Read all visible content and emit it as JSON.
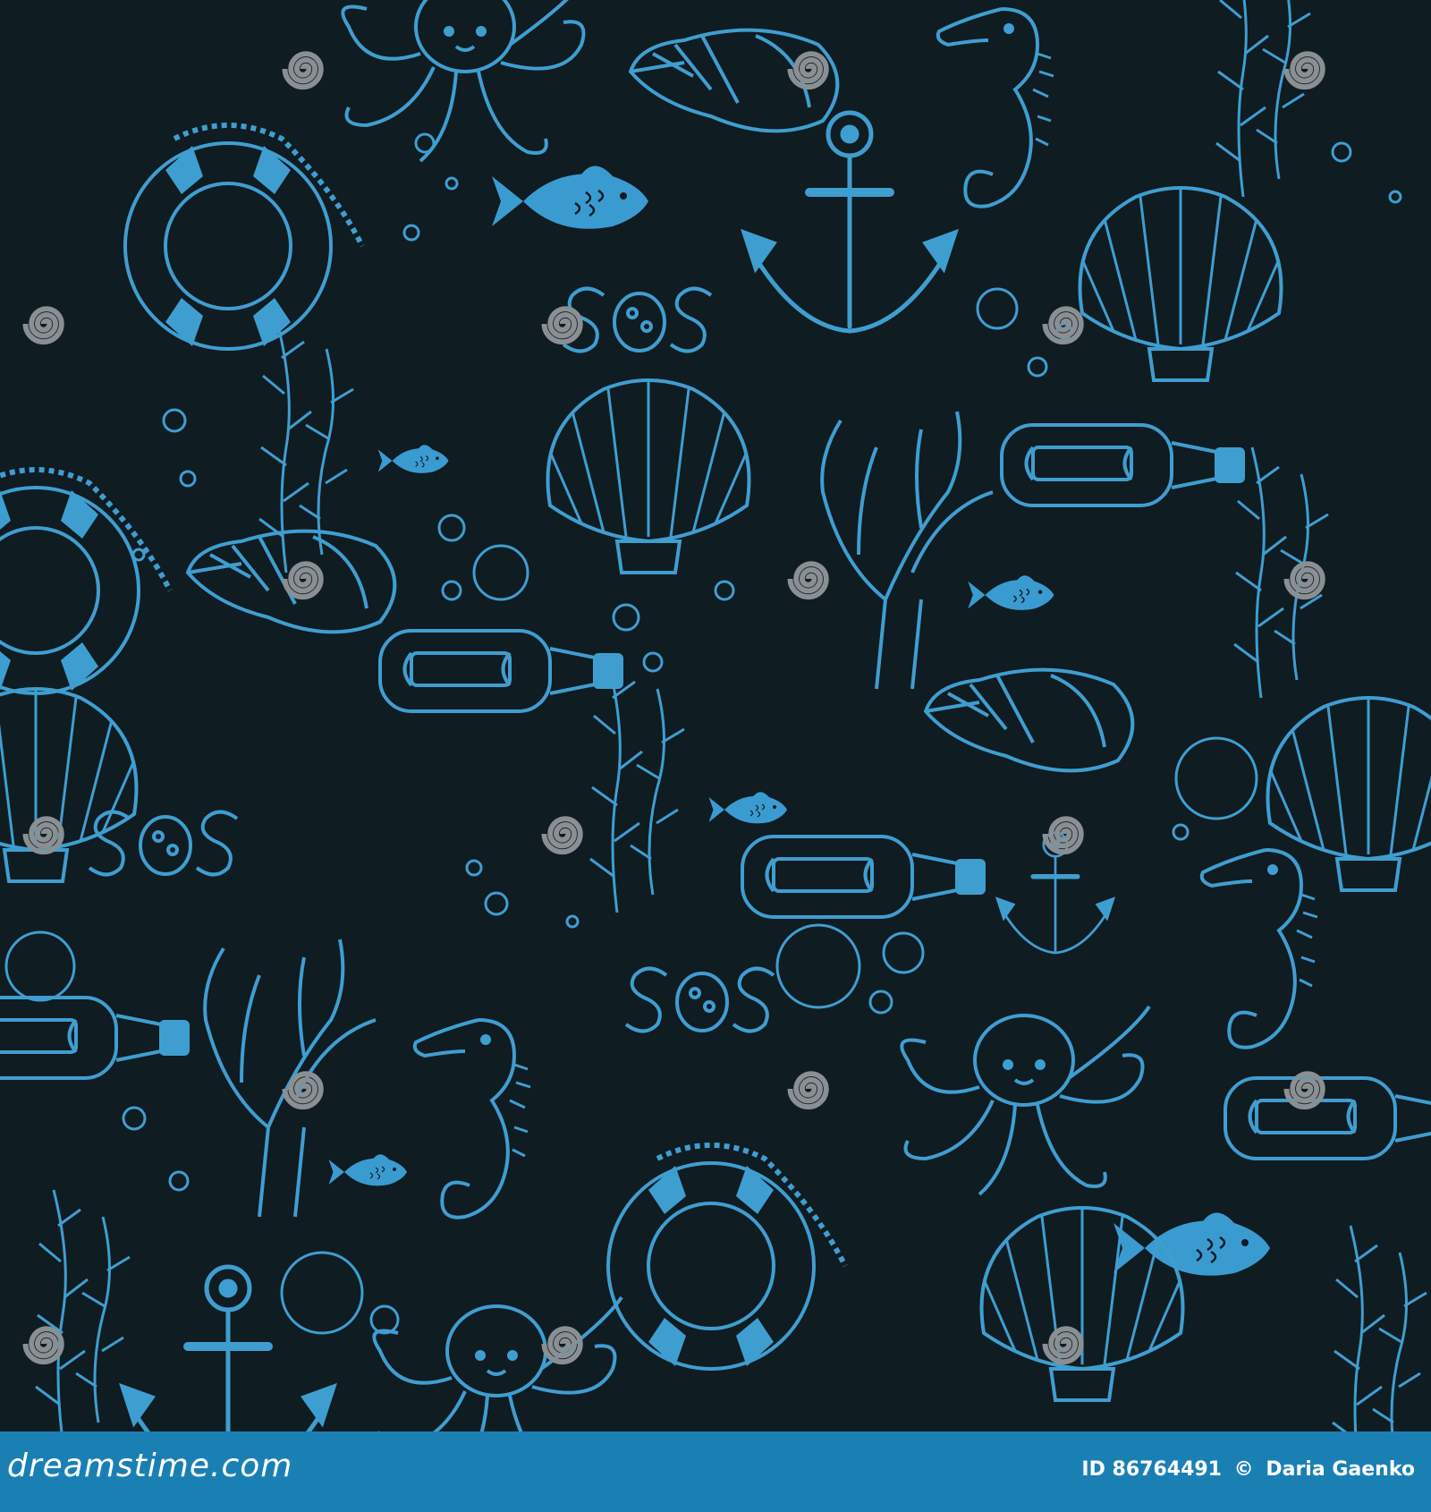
{
  "image": {
    "description_tags": [
      "sea",
      "anchor",
      "octopus",
      "seahorse",
      "seashell",
      "fish",
      "lifebuoy",
      "message-in-bottle",
      "coral",
      "seaweed",
      "bubbles",
      "SOS"
    ],
    "colors": {
      "background": "#0f1c22",
      "line": "#3f9ed0",
      "fill": "#3a9bd1",
      "watermark": "#8a8f93",
      "footer": "#1a80b4",
      "footer_text": "#ffffff"
    }
  },
  "sos_text": "SOS",
  "watermark": {
    "text": "dreamstime"
  },
  "footer": {
    "logo": "dreamstime.com",
    "id_label": "ID 86764491",
    "copyright": "©",
    "author": "Daria Gaenko"
  }
}
